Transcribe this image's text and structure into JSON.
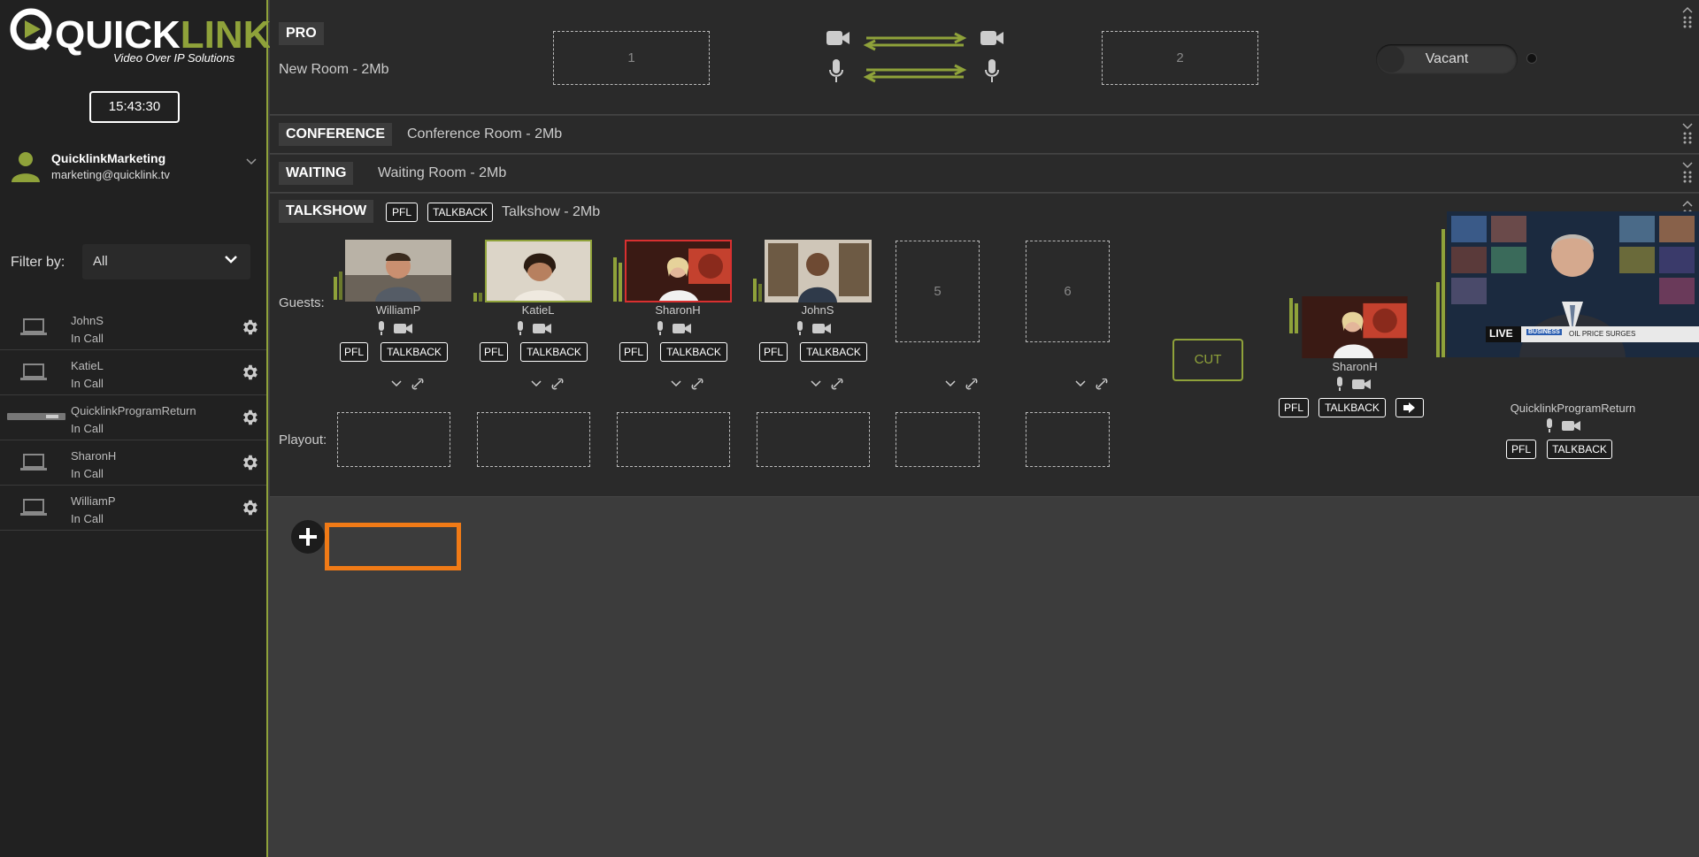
{
  "brand": {
    "logo_main": "QUICK",
    "logo_accent": "LINK",
    "tagline": "Video Over IP Solutions",
    "accent_color": "#8fa23a"
  },
  "sidebar": {
    "clock": "15:43:30",
    "user": {
      "name": "QuicklinkMarketing",
      "email": "marketing@quicklink.tv"
    },
    "filter": {
      "label": "Filter by:",
      "value": "All"
    },
    "participants": [
      {
        "name": "JohnS",
        "status": "In Call",
        "icon": "laptop-icon"
      },
      {
        "name": "KatieL",
        "status": "In Call",
        "icon": "laptop-icon"
      },
      {
        "name": "QuicklinkProgramReturn",
        "status": "In Call",
        "icon": "pro-device-icon"
      },
      {
        "name": "SharonH",
        "status": "In Call",
        "icon": "laptop-icon"
      },
      {
        "name": "WilliamP",
        "status": "In Call",
        "icon": "laptop-icon"
      }
    ]
  },
  "rooms": {
    "pro": {
      "tag": "PRO",
      "name": "New Room - 2Mb",
      "slot1": "1",
      "slot2": "2",
      "vacant": "Vacant"
    },
    "conference": {
      "tag": "CONFERENCE",
      "name": "Conference Room - 2Mb"
    },
    "waiting": {
      "tag": "WAITING",
      "name": "Waiting Room - 2Mb"
    },
    "talkshow": {
      "tag": "TALKSHOW",
      "pfl": "PFL",
      "talkback": "TALKBACK",
      "name": "Talkshow - 2Mb",
      "guests_label": "Guests:",
      "playout_label": "Playout:",
      "guests": [
        {
          "name": "WilliamP",
          "pfl": "PFL",
          "talkback": "TALKBACK"
        },
        {
          "name": "KatieL",
          "pfl": "PFL",
          "talkback": "TALKBACK"
        },
        {
          "name": "SharonH",
          "pfl": "PFL",
          "talkback": "TALKBACK"
        },
        {
          "name": "JohnS",
          "pfl": "PFL",
          "talkback": "TALKBACK"
        }
      ],
      "empty_slots": [
        "5",
        "6"
      ],
      "cut": "CUT",
      "preview": {
        "name": "SharonH",
        "pfl": "PFL",
        "talkback": "TALKBACK"
      },
      "program": {
        "name": "QuicklinkProgramReturn",
        "pfl": "PFL",
        "talkback": "TALKBACK",
        "live": "LIVE",
        "badge": "BUSINESS",
        "ticker": "OIL PRICE SURGES"
      }
    }
  }
}
